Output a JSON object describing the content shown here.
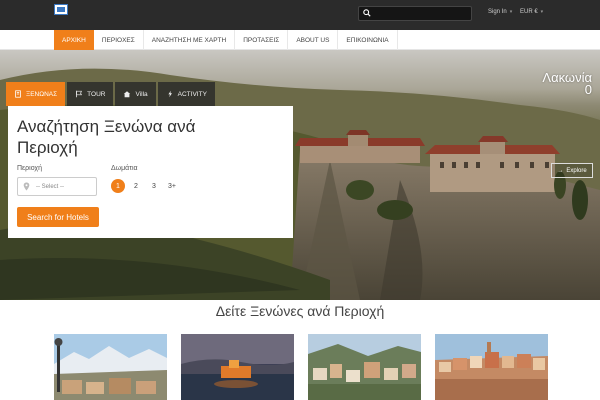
{
  "topbar": {
    "signin": "Sign In",
    "currency": "EUR €",
    "search_placeholder": ""
  },
  "nav": {
    "items": [
      "ΑΡΧΙΚΗ",
      "ΠΕΡΙΟΧΕΣ",
      "ΑΝΑΖΗΤΗΣΗ ΜΕ ΧΑΡΤΗ",
      "ΠΡΟΤΑΣΕΙΣ",
      "ABOUT US",
      "ΕΠΙΚΟΙΝΩΝΙΑ"
    ],
    "active_index": 0
  },
  "hero": {
    "region_name": "Λακωνία",
    "region_count": "0",
    "explore_label": "Explore"
  },
  "tabs": [
    {
      "label": "ΞΕΝΩΝΑΣ",
      "icon": "building-icon",
      "active": true
    },
    {
      "label": "TOUR",
      "icon": "flag-icon",
      "active": false
    },
    {
      "label": "Villa",
      "icon": "home-icon",
      "active": false
    },
    {
      "label": "ACTIVITY",
      "icon": "bolt-icon",
      "active": false
    }
  ],
  "panel": {
    "title": "Αναζήτηση Ξενώνα ανά Περιοχή",
    "region_label": "Περιοχή",
    "region_select": "-- Select --",
    "rooms_label": "Δωμάτια",
    "rooms": [
      "1",
      "2",
      "3",
      "3+"
    ],
    "rooms_selected": "1",
    "search_button": "Search for Hotels"
  },
  "section": {
    "title": "Δείτε Ξενώνες ανά Περιοχή"
  },
  "colors": {
    "accent": "#f07f1a",
    "topbar": "#2b2b2b"
  }
}
